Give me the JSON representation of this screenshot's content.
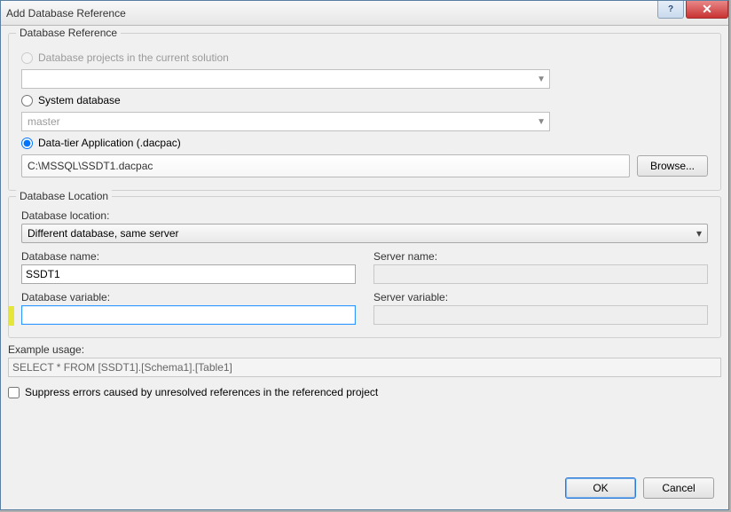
{
  "window": {
    "title": "Add Database Reference"
  },
  "reference": {
    "group_title": "Database Reference",
    "radio_projects": "Database projects in the current solution",
    "projects_combo_value": "",
    "radio_system": "System database",
    "system_combo_value": "master",
    "radio_dacpac": "Data-tier Application (.dacpac)",
    "dacpac_path": "C:\\MSSQL\\SSDT1.dacpac",
    "browse_label": "Browse..."
  },
  "location": {
    "group_title": "Database Location",
    "location_label": "Database location:",
    "location_value": "Different database, same server",
    "db_name_label": "Database name:",
    "db_name_value": "SSDT1",
    "server_name_label": "Server name:",
    "server_name_value": "",
    "db_var_label": "Database variable:",
    "db_var_value": "",
    "server_var_label": "Server variable:",
    "server_var_value": ""
  },
  "example": {
    "label": "Example usage:",
    "value": "SELECT * FROM [SSDT1].[Schema1].[Table1]"
  },
  "suppress": {
    "label": "Suppress errors caused by unresolved references in the referenced project"
  },
  "buttons": {
    "ok": "OK",
    "cancel": "Cancel"
  }
}
